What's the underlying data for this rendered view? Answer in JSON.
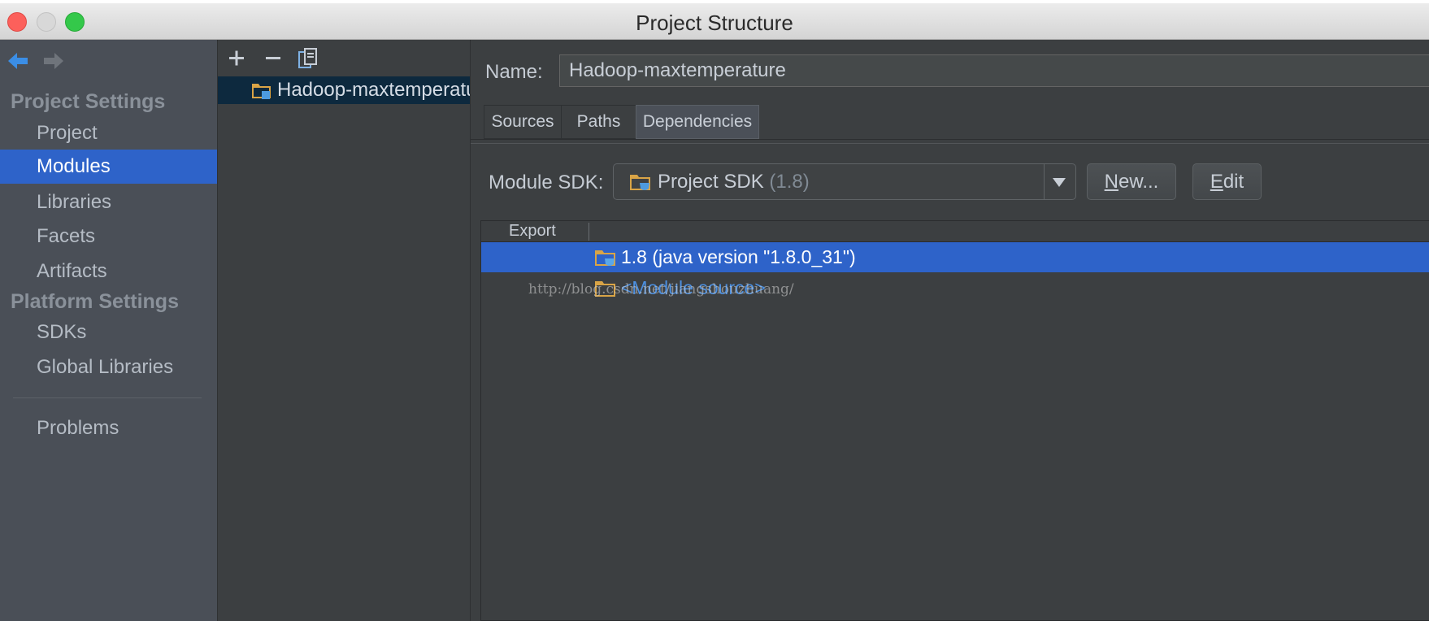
{
  "window": {
    "title": "Project Structure"
  },
  "sidebar": {
    "project_settings_header": "Project Settings",
    "project_items": [
      {
        "label": "Project"
      },
      {
        "label": "Modules"
      },
      {
        "label": "Libraries"
      },
      {
        "label": "Facets"
      },
      {
        "label": "Artifacts"
      }
    ],
    "platform_settings_header": "Platform Settings",
    "platform_items": [
      {
        "label": "SDKs"
      },
      {
        "label": "Global Libraries"
      }
    ],
    "problems_label": "Problems",
    "selected": "Modules"
  },
  "modules_list": {
    "items": [
      {
        "label": "Hadoop-maxtemperature"
      }
    ]
  },
  "module": {
    "name_label": "Name:",
    "name_value": "Hadoop-maxtemperature",
    "tabs": [
      {
        "label": "Sources"
      },
      {
        "label": "Paths"
      },
      {
        "label": "Dependencies"
      }
    ],
    "active_tab": "Dependencies",
    "sdk_label": "Module SDK:",
    "sdk_value": "Project SDK",
    "sdk_version": "(1.8)",
    "new_button": {
      "mnemonic": "N",
      "rest": "ew..."
    },
    "edit_button": {
      "mnemonic": "E",
      "rest": "dit"
    },
    "table": {
      "columns": [
        "Export"
      ],
      "rows": [
        {
          "label": "1.8 (java version \"1.8.0_31\")",
          "selected": true
        },
        {
          "label": "<Module source>",
          "selected": false
        }
      ]
    },
    "watermark": "http://blog.csdn.net/jiangshouzhuang/"
  },
  "colors": {
    "selection": "#2e63c9",
    "link": "#4c8fdf",
    "panel": "#3c3f41",
    "sidebar": "#4a4f57"
  }
}
